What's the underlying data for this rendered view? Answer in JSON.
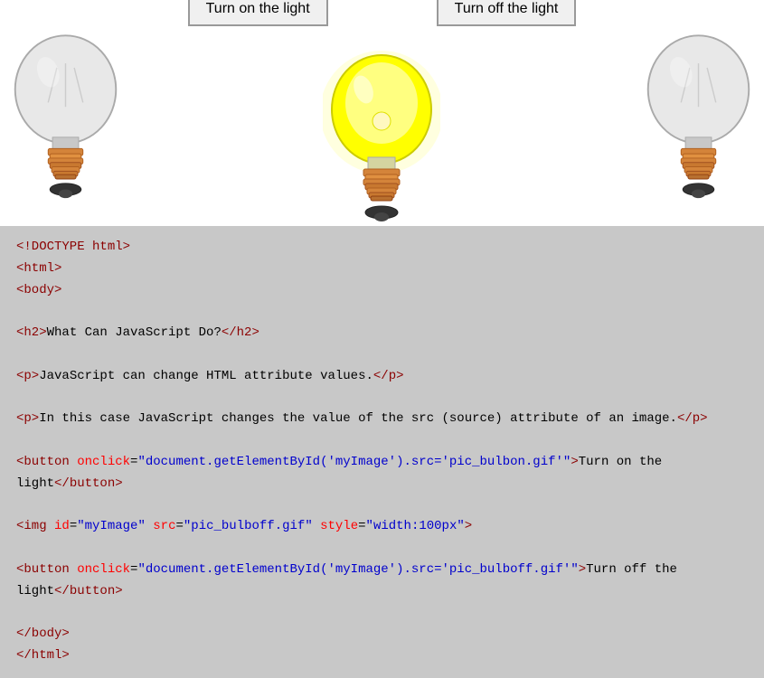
{
  "demo": {
    "btn_on_label": "Turn on the light",
    "btn_off_label": "Turn off the light"
  },
  "code": {
    "lines": [
      {
        "type": "tag",
        "content": "<!DOCTYPE html>"
      },
      {
        "type": "tag",
        "content": "<html>"
      },
      {
        "type": "tag",
        "content": "<body>"
      },
      {
        "type": "blank"
      },
      {
        "type": "mixed",
        "parts": [
          {
            "cls": "tag",
            "t": "<h2>"
          },
          {
            "cls": "text-content",
            "t": "What Can JavaScript Do?"
          },
          {
            "cls": "tag",
            "t": "</h2>"
          }
        ]
      },
      {
        "type": "blank"
      },
      {
        "type": "mixed",
        "parts": [
          {
            "cls": "tag",
            "t": "<p>"
          },
          {
            "cls": "text-content",
            "t": "JavaScript can change HTML attribute values."
          },
          {
            "cls": "tag",
            "t": "</p>"
          }
        ]
      },
      {
        "type": "blank"
      },
      {
        "type": "mixed",
        "parts": [
          {
            "cls": "tag",
            "t": "<p>"
          },
          {
            "cls": "text-content",
            "t": "In this case JavaScript changes the value of the src (source) attribute of an image."
          },
          {
            "cls": "tag",
            "t": "</p>"
          }
        ]
      },
      {
        "type": "blank"
      },
      {
        "type": "mixed",
        "parts": [
          {
            "cls": "tag",
            "t": "<button "
          },
          {
            "cls": "attr-name",
            "t": "onclick"
          },
          {
            "cls": "text-content",
            "t": "="
          },
          {
            "cls": "attr-value",
            "t": "\"document.getElementById('myImage').src='pic_bulbon.gif'\""
          },
          {
            "cls": "tag",
            "t": ">"
          },
          {
            "cls": "text-content",
            "t": "Turn on the\nlight"
          },
          {
            "cls": "tag",
            "t": "</button>"
          }
        ]
      },
      {
        "type": "blank"
      },
      {
        "type": "mixed",
        "parts": [
          {
            "cls": "tag",
            "t": "<img "
          },
          {
            "cls": "attr-name",
            "t": "id"
          },
          {
            "cls": "text-content",
            "t": "="
          },
          {
            "cls": "attr-value",
            "t": "\"myImage\""
          },
          {
            "cls": "text-content",
            "t": " "
          },
          {
            "cls": "attr-name",
            "t": "src"
          },
          {
            "cls": "text-content",
            "t": "="
          },
          {
            "cls": "attr-value",
            "t": "\"pic_bulboff.gif\""
          },
          {
            "cls": "text-content",
            "t": " "
          },
          {
            "cls": "attr-name",
            "t": "style"
          },
          {
            "cls": "text-content",
            "t": "="
          },
          {
            "cls": "attr-value",
            "t": "\"width:100px\""
          },
          {
            "cls": "tag",
            "t": ">"
          }
        ]
      },
      {
        "type": "blank"
      },
      {
        "type": "mixed",
        "parts": [
          {
            "cls": "tag",
            "t": "<button "
          },
          {
            "cls": "attr-name",
            "t": "onclick"
          },
          {
            "cls": "text-content",
            "t": "="
          },
          {
            "cls": "attr-value",
            "t": "\"document.getElementById('myImage').src='pic_bulboff.gif'\""
          },
          {
            "cls": "tag",
            "t": ">"
          },
          {
            "cls": "text-content",
            "t": "Turn off the\nlight"
          },
          {
            "cls": "tag",
            "t": "</button>"
          }
        ]
      },
      {
        "type": "blank"
      },
      {
        "type": "tag",
        "content": "</body>"
      },
      {
        "type": "tag",
        "content": "</html>"
      }
    ]
  }
}
